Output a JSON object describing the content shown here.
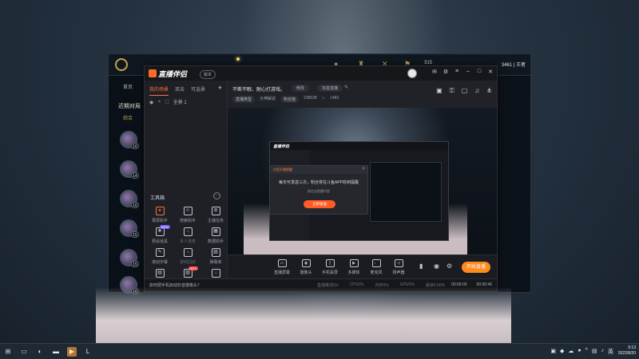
{
  "taskbar": {
    "time": "9:13",
    "date": "2022/8/20"
  },
  "lol_client": {
    "nav_home": "首页",
    "recent_title": "近期对局",
    "filter_tab": "综合",
    "rp_value": "315",
    "user_name": "3461 | 王者",
    "levels": [
      "16",
      "14",
      "16",
      "15",
      "15",
      "16"
    ]
  },
  "app": {
    "brand": "直播伴侣",
    "version_chip": "版本",
    "tabs": [
      "我的场景",
      "双击",
      "可选景"
    ],
    "scene_name": "全景 1",
    "toolbox_title": "工具箱",
    "tools": [
      {
        "icon": "record-icon",
        "label": "录屏助手",
        "dim": false,
        "hot": true,
        "badge": ""
      },
      {
        "icon": "smile-icon",
        "label": "搜索助手",
        "dim": false,
        "hot": false,
        "badge": ""
      },
      {
        "icon": "list-icon",
        "label": "主播任务",
        "dim": false,
        "hot": false,
        "badge": ""
      },
      {
        "icon": "gift-icon",
        "label": "预设道具",
        "dim": false,
        "hot": false,
        "badge": "NEW"
      },
      {
        "icon": "download-icon",
        "label": "多人连麦",
        "dim": true,
        "hot": false,
        "badge": ""
      },
      {
        "icon": "chart-icon",
        "label": "数据助手",
        "dim": false,
        "hot": false,
        "badge": ""
      },
      {
        "icon": "edit-icon",
        "label": "滚动字幕",
        "dim": false,
        "hot": false,
        "badge": ""
      },
      {
        "icon": "download-icon",
        "label": "游戏回放",
        "dim": true,
        "hot": false,
        "badge": ""
      },
      {
        "icon": "picture-icon",
        "label": "弹幕库",
        "dim": false,
        "hot": false,
        "badge": ""
      },
      {
        "icon": "panel-icon",
        "label": "",
        "dim": false,
        "hot": false,
        "badge": ""
      },
      {
        "icon": "image-icon",
        "label": "",
        "dim": false,
        "hot": false,
        "badge": "HOT"
      },
      {
        "icon": "download-icon",
        "label": "",
        "dim": false,
        "hot": false,
        "badge": ""
      }
    ],
    "live_title": "不断不眠、耐心打游戏。",
    "chip_modify": "修改",
    "chip_notice": "完善直播",
    "info_type_label": "直播类型",
    "info_type_value": "大神解说",
    "info_fans_label": "粉丝值",
    "info_fans_value": "238538",
    "info_hot_value": "1482",
    "dialog": {
      "header": "抖音开播提醒",
      "message": "每天可发送三次，粉丝将在斗鱼APP收到提醒",
      "sub": "前往去提醒内容",
      "button": "立即发送"
    },
    "controls": [
      {
        "icon": "monitor-icon",
        "label": "直播屏幕"
      },
      {
        "icon": "camera-icon",
        "label": "摄像头"
      },
      {
        "icon": "phone-icon",
        "label": "手机投屏"
      },
      {
        "icon": "video-icon",
        "label": "多媒体"
      },
      {
        "icon": "mic-icon",
        "label": "麦克风"
      },
      {
        "icon": "speaker-icon",
        "label": "扬声器"
      }
    ],
    "go_live_label": "开始直播",
    "status_tip": "如何把手机启动抖音摄像头？",
    "stats": [
      "直播推流5/s",
      "CPU0%",
      "内存0%",
      "GPU0%",
      "丢帧0.00%"
    ],
    "timer_live": "00:00:00",
    "timer_rec": "00:00:46"
  }
}
